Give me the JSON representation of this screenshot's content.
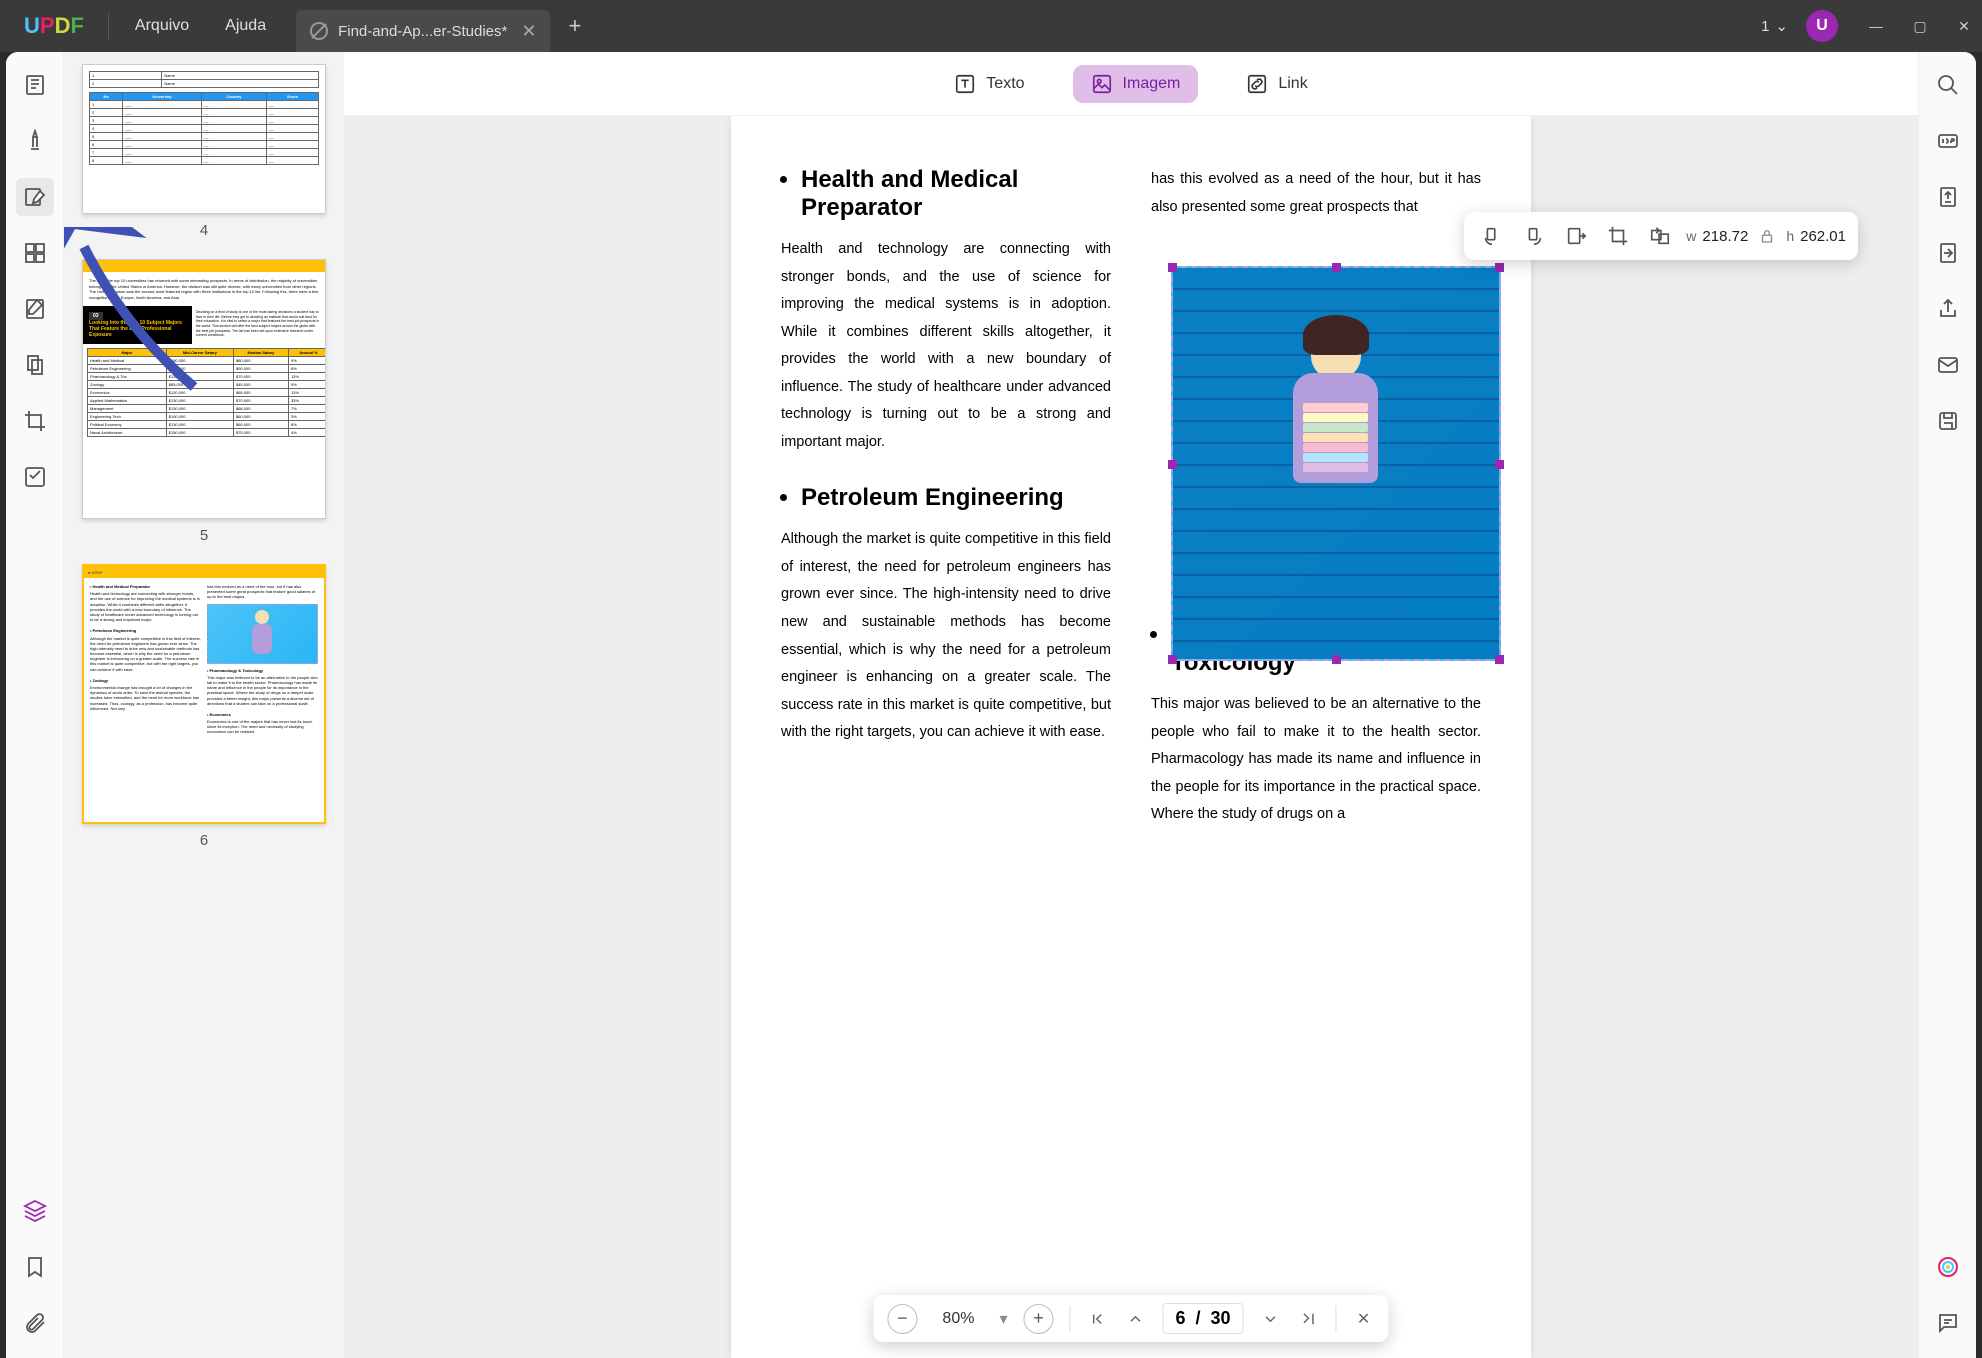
{
  "titlebar": {
    "logo": "UPDF",
    "menu": {
      "file": "Arquivo",
      "help": "Ajuda"
    },
    "tab": {
      "label": "Find-and-Ap...er-Studies*"
    },
    "count": "1",
    "avatar_initial": "U"
  },
  "toolbar": {
    "text": "Texto",
    "image": "Imagem",
    "link": "Link"
  },
  "thumbnails": {
    "page4": {
      "num": "4"
    },
    "page5": {
      "num": "5",
      "badge": "03",
      "title": "Looking Into the Top 10 Subject Majors That Feature the Best Professional Exposure"
    },
    "page6": {
      "num": "6",
      "h1": "Health and Medical Preparator",
      "h2": "Petroleum Engineering",
      "h3": "Pharmacology & Toxicology",
      "h4": "Zoology",
      "h5": "Economics"
    }
  },
  "document": {
    "heading1": "Health and Medical Preparator",
    "para1": "Health and technology are connecting with stronger bonds, and the use of science for improving the medical systems is in adoption. While it combines different skills altogether, it provides the world with a new boundary of influence. The study of healthcare under advanced technology is turning out to be a strong and important major.",
    "heading2": "Petroleum Engineering",
    "para2": "Although the market is quite competitive in this field of interest, the need for petroleum engineers has grown ever since. The high-intensity need to drive new and sustainable methods has become essential, which is why the need for a petroleum engineer is enhancing on a greater scale. The success rate in this market is quite competitive, but with the right targets, you can achieve it with ease.",
    "col2_intro": "has this evolved as a need of the hour, but it has also presented some great prospects that",
    "heading3": "Pharmacology & Toxicology",
    "para3": "This major was believed to be an alternative to the people who fail to make it to the health sector. Pharmacology has made its name and influence in the people for its importance in the practical space. Where the study of drugs on a"
  },
  "image_toolbar": {
    "w_label": "w",
    "w_value": "218.72",
    "h_label": "h",
    "h_value": "262.01"
  },
  "bottom_bar": {
    "zoom": "80%",
    "page_current": "6",
    "page_sep": "/",
    "page_total": "30"
  }
}
